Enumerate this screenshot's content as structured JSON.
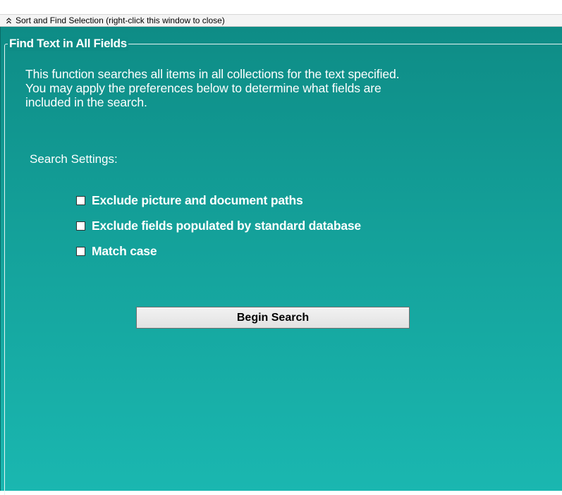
{
  "window": {
    "title": "Sort and Find Selection (right-click this window to close)",
    "collapse_icon": "double-chevron-up-icon"
  },
  "group": {
    "title": "Find Text in All Fields"
  },
  "description": {
    "line1": "This function searches all items in all collections for the text specified.",
    "line2": "You may apply the preferences below to determine what fields are",
    "line3": "included in the search."
  },
  "settings": {
    "label": "Search Settings:",
    "options": [
      {
        "label": "Exclude picture and document paths",
        "checked": false
      },
      {
        "label": "Exclude fields populated by standard database",
        "checked": false
      },
      {
        "label": "Match case",
        "checked": false
      }
    ]
  },
  "actions": {
    "begin_search_label": "Begin Search"
  },
  "colors": {
    "panel_top": "#0e8c86",
    "panel_bottom": "#1ab7b0",
    "text": "#ffffff"
  }
}
